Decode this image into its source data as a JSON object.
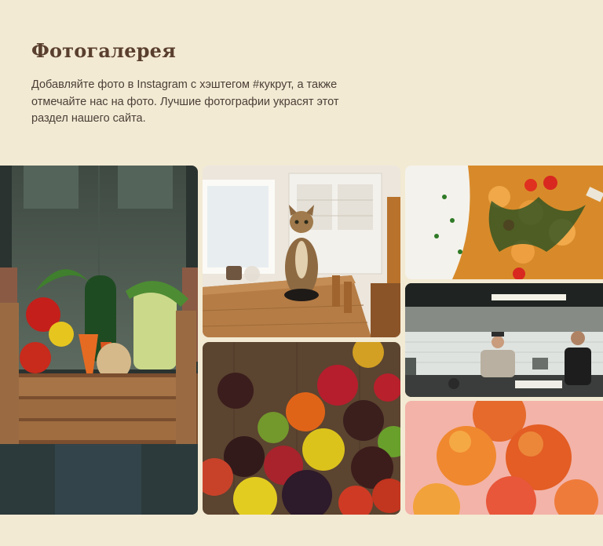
{
  "gallery": {
    "title": "Фотогалерея",
    "description": "Добавляйте фото в Instagram с хэштегом #кукрут, а также отмечайте нас на фото. Лучшие фотографии украсят этот раздел нашего сайта.",
    "photos": [
      {
        "id": "farmer",
        "subject": "farmer-vegetable-crate-photo"
      },
      {
        "id": "cat",
        "subject": "cat-on-table-photo"
      },
      {
        "id": "tomatoes",
        "subject": "heirloom-tomatoes-photo"
      },
      {
        "id": "rice",
        "subject": "rice-curry-dish-photo"
      },
      {
        "id": "kitchen",
        "subject": "restaurant-kitchen-chefs-photo"
      },
      {
        "id": "peaches",
        "subject": "peaches-photo"
      }
    ]
  }
}
